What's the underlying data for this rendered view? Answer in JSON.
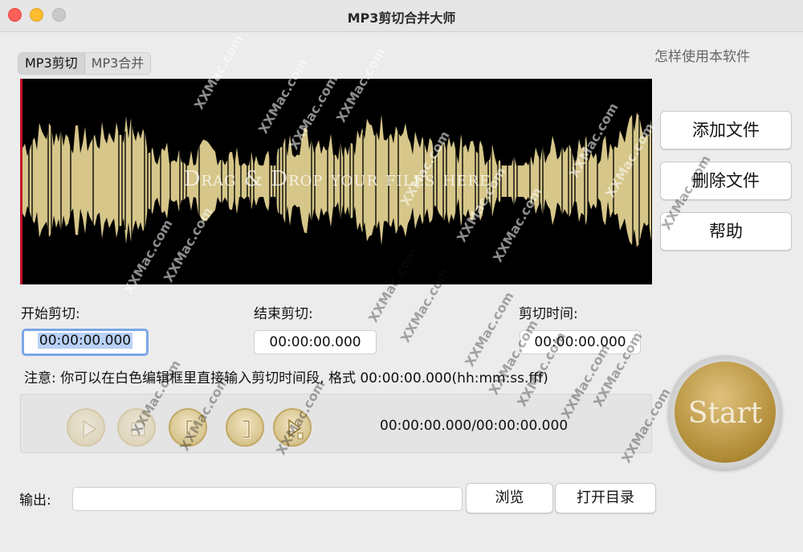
{
  "window": {
    "title": "MP3剪切合并大师"
  },
  "tabs": [
    {
      "label": "MP3剪切"
    },
    {
      "label": "MP3合并"
    }
  ],
  "help_link": "怎样使用本软件",
  "waveform": {
    "drop_text": "Drag & Drop your files here",
    "wave_color": "#d6c689",
    "marker_color": "#c0102a"
  },
  "side_buttons": {
    "add": "添加文件",
    "delete": "删除文件",
    "help": "帮助"
  },
  "cut": {
    "start_label": "开始剪切:",
    "end_label": "结束剪切:",
    "duration_label": "剪切时间:",
    "start_value": "00:00:00.000",
    "end_value": "00:00:00.000",
    "duration_value": "00:00:00.000"
  },
  "note": "注意: 你可以在白色编辑框里直接输入剪切时间段, 格式 00:00:00.000(hh:mm:ss.fff)",
  "player": {
    "time_display": "00:00:00.000/00:00:00.000",
    "buttons": [
      "play-icon",
      "stop-icon",
      "set-start-icon",
      "set-end-icon",
      "play-selection-icon"
    ]
  },
  "start_button": "Start",
  "output": {
    "label": "输出:",
    "value": "",
    "browse": "浏览",
    "open_dir": "打开目录"
  },
  "watermark": "XXMac.com",
  "colors": {
    "accent_gold": "#b08b35",
    "focus_ring": "#7aa7e6"
  }
}
